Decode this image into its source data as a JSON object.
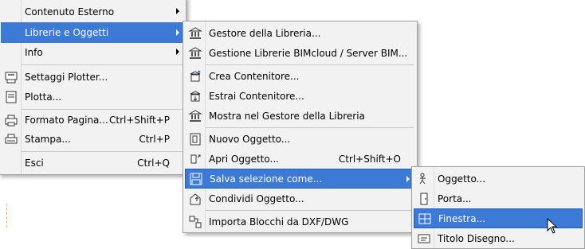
{
  "main_menu": {
    "items": [
      {
        "label": "Contenuto Esterno"
      },
      {
        "label": "Librerie e Oggetti"
      },
      {
        "label": "Info"
      },
      {
        "label": "Settaggi Plotter..."
      },
      {
        "label": "Plotta..."
      },
      {
        "label": "Formato Pagina...",
        "shortcut": "Ctrl+Shift+P"
      },
      {
        "label": "Stampa...",
        "shortcut": "Ctrl+P"
      },
      {
        "label": "Esci",
        "shortcut": "Ctrl+Q"
      }
    ]
  },
  "library_menu": {
    "items": [
      {
        "label": "Gestore della Libreria..."
      },
      {
        "label": "Gestione Librerie BIMcloud / Server BIM..."
      },
      {
        "label": "Crea Contenitore..."
      },
      {
        "label": "Estrai Contenitore..."
      },
      {
        "label": "Mostra nel Gestore della Libreria"
      },
      {
        "label": "Nuovo Oggetto..."
      },
      {
        "label": "Apri Oggetto...",
        "shortcut": "Ctrl+Shift+O"
      },
      {
        "label": "Salva selezione come..."
      },
      {
        "label": "Condividi Oggetto..."
      },
      {
        "label": "Importa Blocchi da DXF/DWG"
      }
    ]
  },
  "save_menu": {
    "items": [
      {
        "label": "Oggetto..."
      },
      {
        "label": "Porta..."
      },
      {
        "label": "Finestra..."
      },
      {
        "label": "Titolo Disegno..."
      }
    ]
  },
  "colors": {
    "highlight": "#3c7ad6",
    "menu_bg": "#f2f2f2",
    "border": "#a0a0a0"
  }
}
